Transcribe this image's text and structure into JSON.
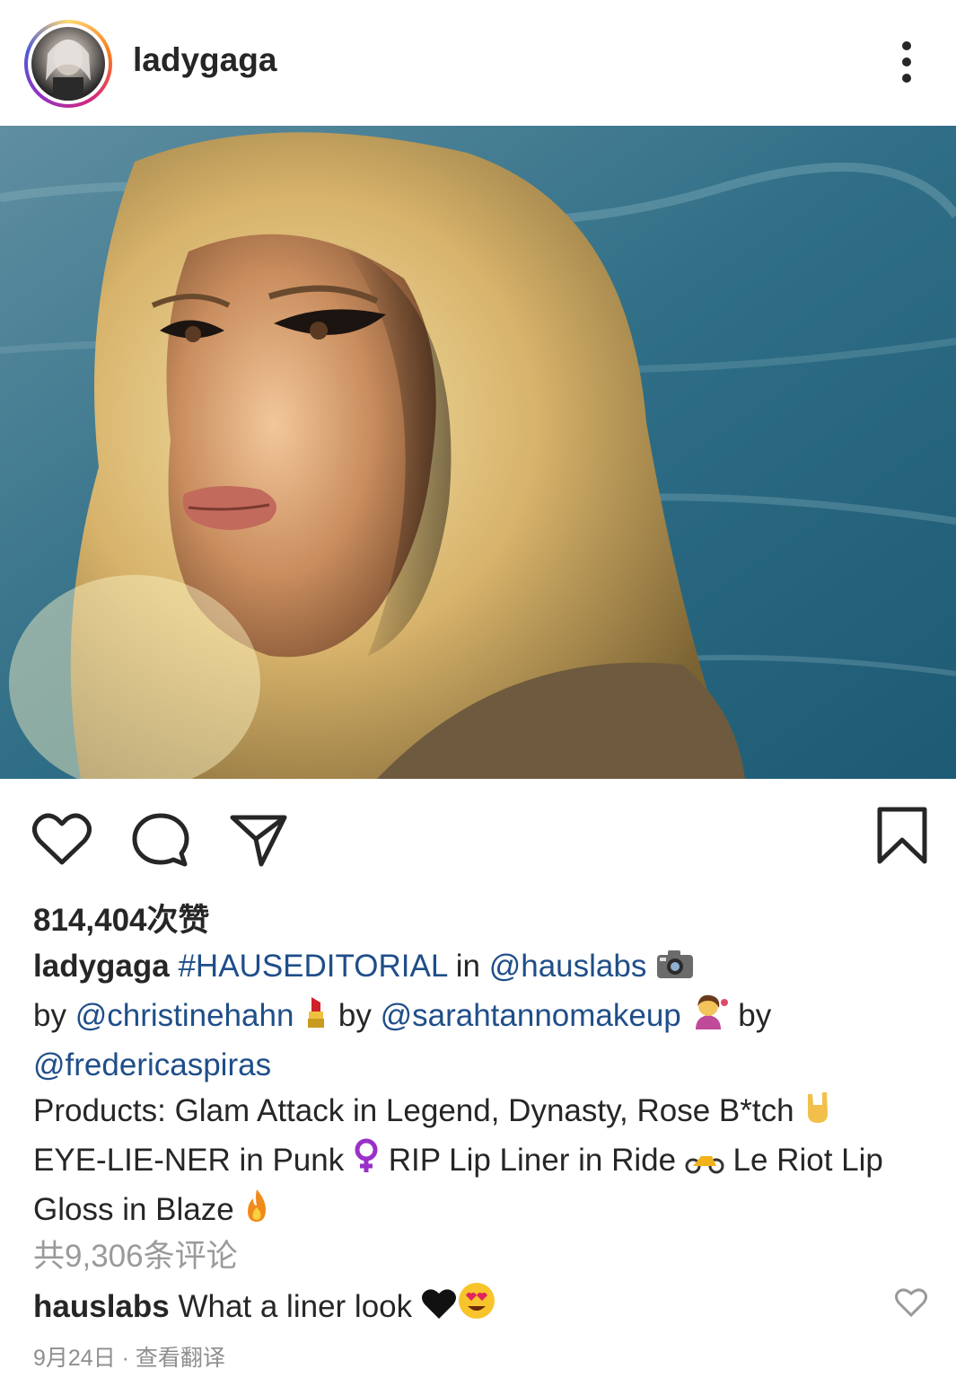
{
  "header": {
    "username": "ladygaga",
    "menu_icon": "more-vertical-icon"
  },
  "post": {
    "photo_alt": "portrait-photo",
    "likes": "814,404次赞",
    "caption": {
      "username": "ladygaga",
      "hashtag": "#HAUSEDITORIAL",
      "t_in": " in ",
      "m1": "@hauslabs",
      "t_by1": " by ",
      "m2": "@christinehahn",
      "t_by2": " by ",
      "m3": "@sarahtannomakeup",
      "t_by3": " by ",
      "m4": "@fredericaspiras",
      "line_products": "Products: Glam Attack in Legend, Dynasty, Rose B*tch",
      "line_eye_a": "EYE-LIE-NER in Punk ",
      "line_eye_b": " RIP Lip Liner in Ride ",
      "line_eye_c": " Le Riot Lip",
      "line_gloss": "Gloss in Blaze "
    },
    "comments_link": "共9,306条评论",
    "top_comment": {
      "username": "hauslabs",
      "text": " What a liner look "
    },
    "date": "9月24日 · 查看翻译"
  },
  "icons": [
    "heart-icon",
    "comment-icon",
    "share-icon",
    "bookmark-icon",
    "camera-emoji",
    "lipstick-emoji",
    "woman-tipping-hand-emoji",
    "horns-hand-emoji",
    "female-sign-emoji",
    "motorcycle-emoji",
    "fire-emoji",
    "black-heart-emoji",
    "heart-eyes-emoji"
  ],
  "colors": {
    "mention": "#1f4e89",
    "muted": "#9a9a9a",
    "text": "#262626"
  }
}
